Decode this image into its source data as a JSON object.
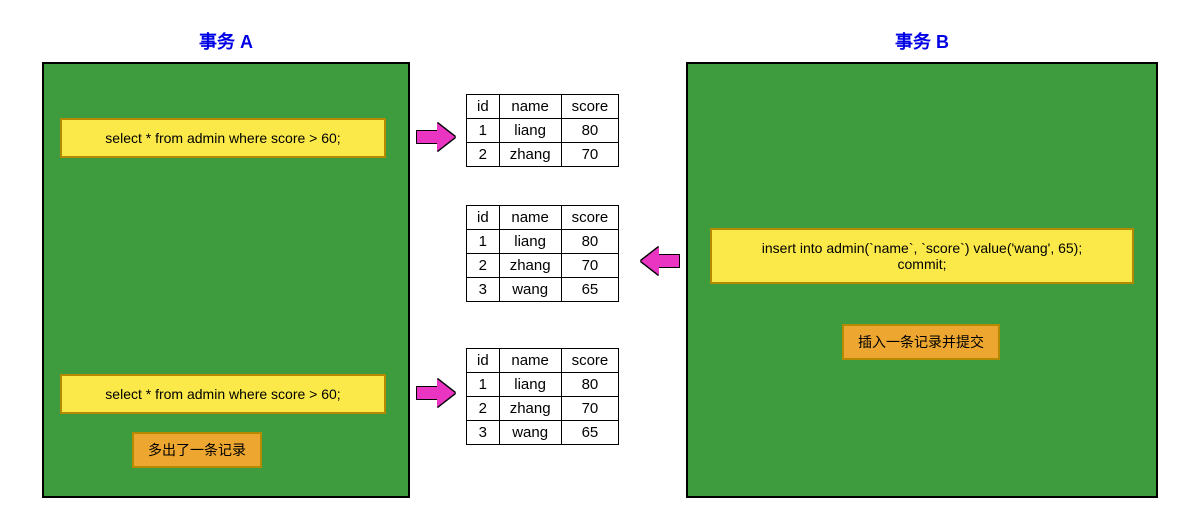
{
  "titles": {
    "a": "事务 A",
    "b": "事务 B"
  },
  "transactionA": {
    "query1": "select * from admin where score > 60;",
    "query2": "select * from admin where score > 60;",
    "note": "多出了一条记录"
  },
  "transactionB": {
    "statement": "insert into admin(`name`, `score`) value('wang', 65);\ncommit;",
    "note": "插入一条记录并提交"
  },
  "tableHeaders": {
    "id": "id",
    "name": "name",
    "score": "score"
  },
  "result1": [
    {
      "id": "1",
      "name": "liang",
      "score": "80"
    },
    {
      "id": "2",
      "name": "zhang",
      "score": "70"
    }
  ],
  "result2": [
    {
      "id": "1",
      "name": "liang",
      "score": "80"
    },
    {
      "id": "2",
      "name": "zhang",
      "score": "70"
    },
    {
      "id": "3",
      "name": "wang",
      "score": "65"
    }
  ],
  "result3": [
    {
      "id": "1",
      "name": "liang",
      "score": "80"
    },
    {
      "id": "2",
      "name": "zhang",
      "score": "70"
    },
    {
      "id": "3",
      "name": "wang",
      "score": "65"
    }
  ]
}
